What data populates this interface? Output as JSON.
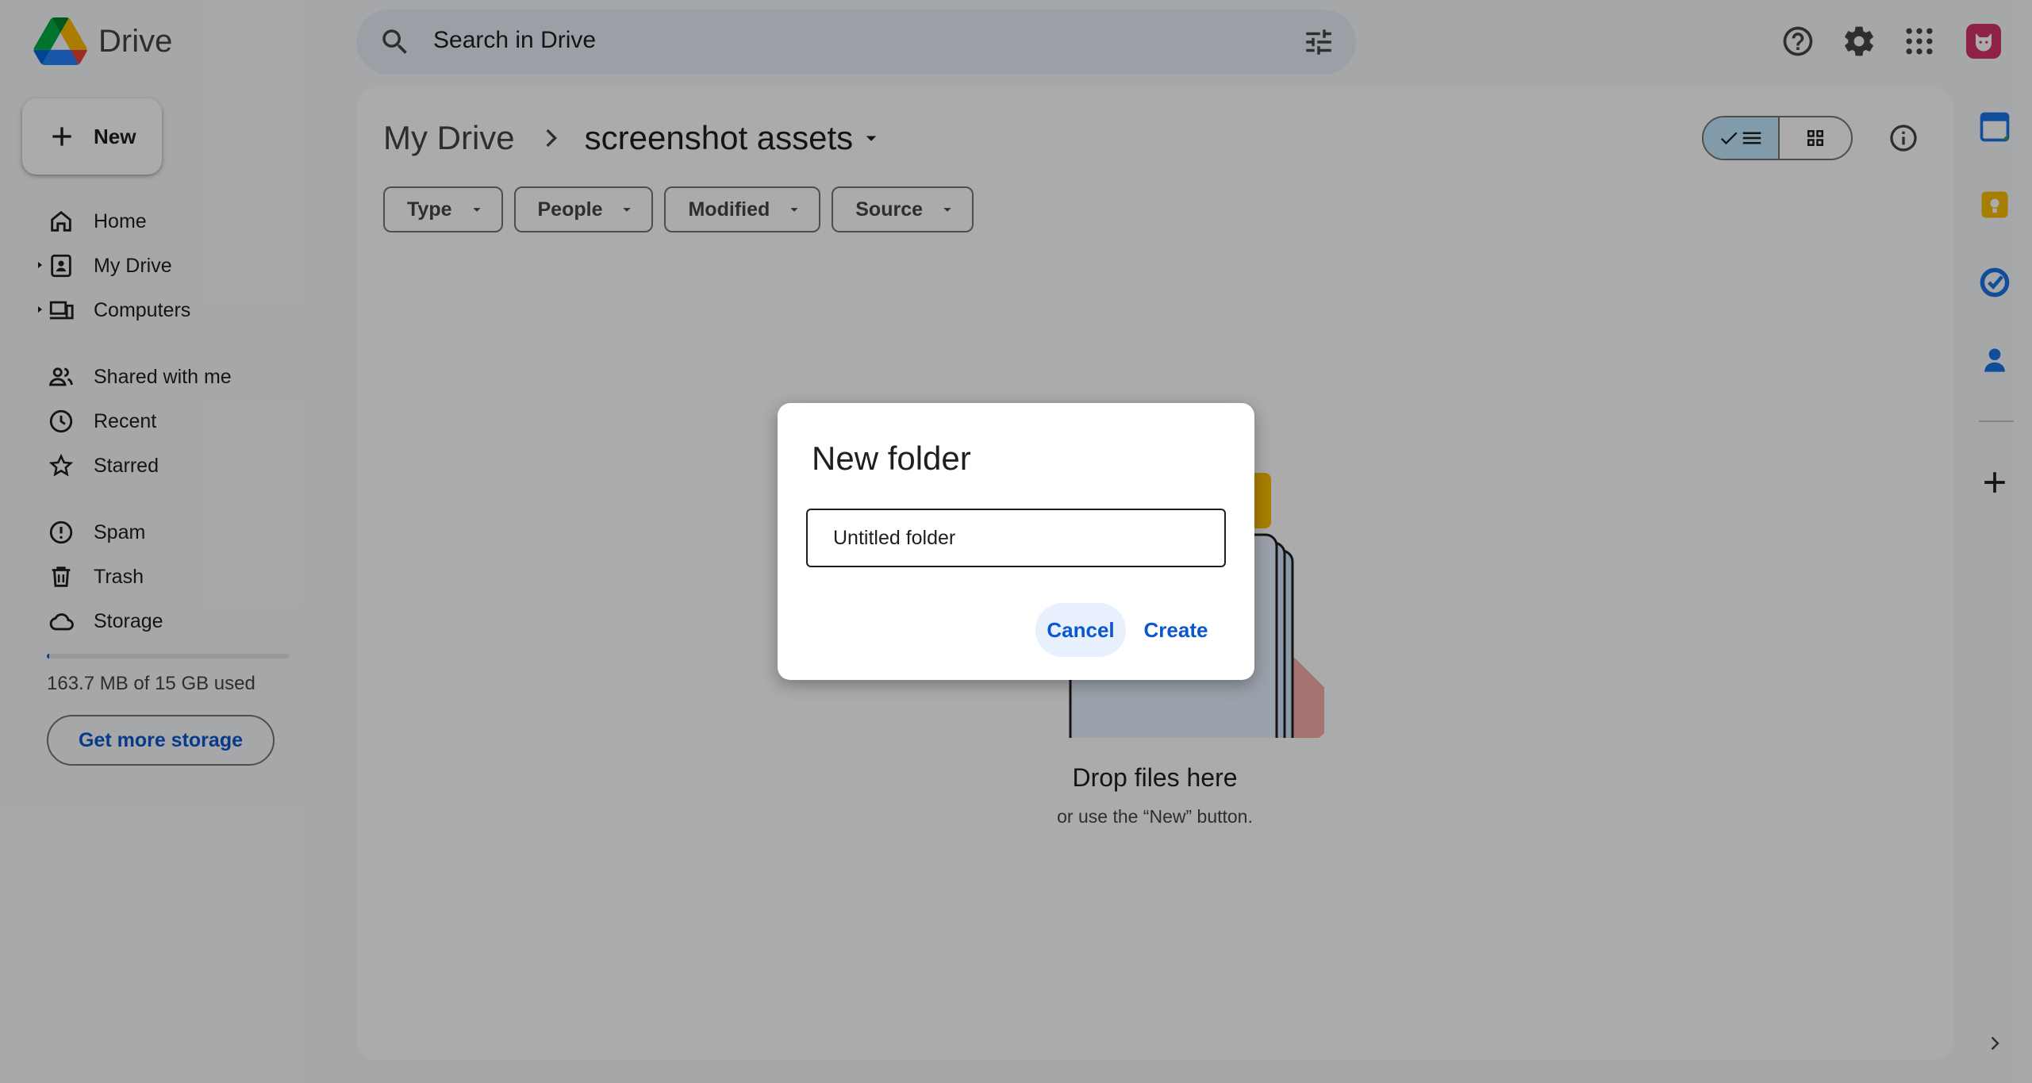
{
  "app": {
    "name": "Drive"
  },
  "search": {
    "placeholder": "Search in Drive"
  },
  "new_button": {
    "label": "New"
  },
  "nav": {
    "items": [
      {
        "label": "Home"
      },
      {
        "label": "My Drive"
      },
      {
        "label": "Computers"
      },
      {
        "label": "Shared with me"
      },
      {
        "label": "Recent"
      },
      {
        "label": "Starred"
      },
      {
        "label": "Spam"
      },
      {
        "label": "Trash"
      },
      {
        "label": "Storage"
      }
    ]
  },
  "storage": {
    "used_text": "163.7 MB of 15 GB used",
    "used_fraction": 0.011,
    "button_label": "Get more storage"
  },
  "breadcrumb": {
    "root": "My Drive",
    "current": "screenshot assets"
  },
  "filters": [
    "Type",
    "People",
    "Modified",
    "Source"
  ],
  "empty_state": {
    "title": "Drop files here",
    "subtitle": "or use the “New” button."
  },
  "dialog": {
    "title": "New folder",
    "input_value": "Untitled folder",
    "cancel_label": "Cancel",
    "create_label": "Create"
  },
  "colors": {
    "accent": "#0b57d0",
    "background": "#f8fafd",
    "selected_toggle": "#c2e7ff"
  },
  "icons": {
    "top_right": [
      "help-icon",
      "settings-icon",
      "apps-grid-icon"
    ],
    "side_panel": [
      "calendar-icon",
      "keep-icon",
      "tasks-icon",
      "contacts-icon",
      "add-icon"
    ]
  }
}
